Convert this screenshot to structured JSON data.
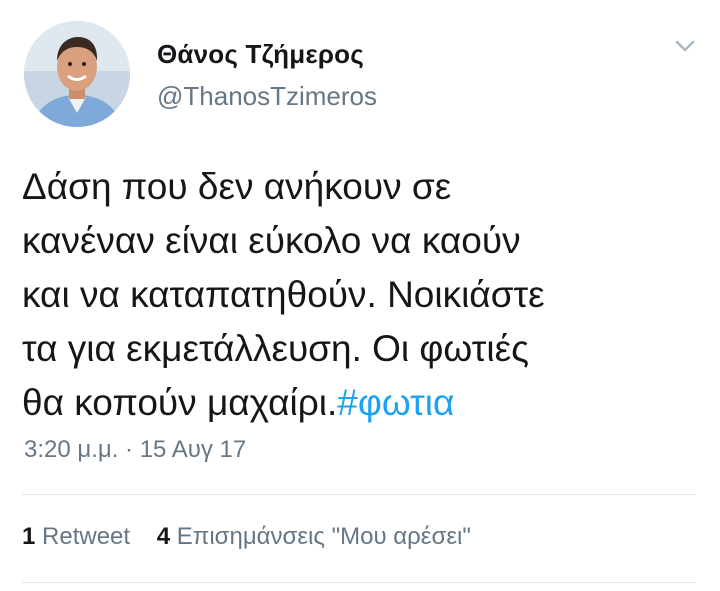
{
  "author": {
    "display_name": "Θάνος Τζήμερος",
    "handle": "@ThanosTzimeros"
  },
  "menu": {
    "icon": "chevron-down-icon"
  },
  "tweet": {
    "lines": [
      "Δάση που δεν ανήκουν σε",
      "κανέναν είναι εύκολο να καούν",
      "και να καταπατηθούν. Νοικιάστε",
      "τα για εκμετάλλευση. Οι φωτιές",
      "θα κοπούν μαχαίρι."
    ],
    "hashtag": "#φωτια"
  },
  "meta": {
    "timestamp": "3:20 μ.μ. · 15 Αυγ 17"
  },
  "stats": {
    "retweets_count": "1",
    "retweets_label": "Retweet",
    "likes_count": "4",
    "likes_label": "Επισημάνσεις \"Μου αρέσει\""
  },
  "colors": {
    "hashtag": "#1da1f2",
    "secondary_text": "#657786",
    "primary_text": "#14171a",
    "divider": "#e1e8ed"
  }
}
